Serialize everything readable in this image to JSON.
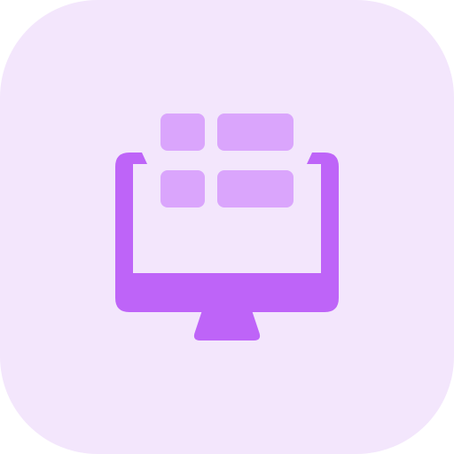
{
  "icon": {
    "name": "computer-monitor-with-table-icon",
    "colors": {
      "tile_background": "#F3E6FC",
      "monitor": "#BE64F8",
      "table_cells": "#DAA5FC"
    }
  }
}
